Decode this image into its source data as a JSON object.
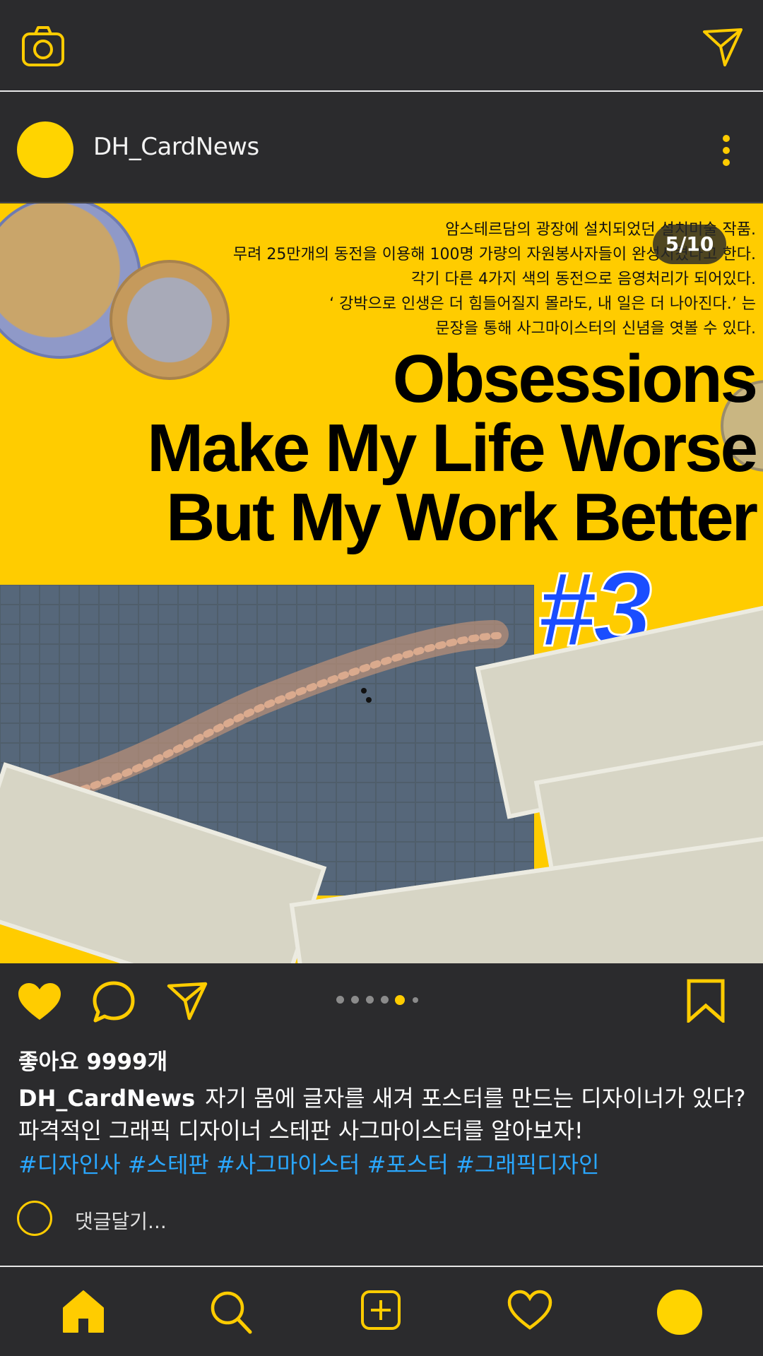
{
  "colors": {
    "accent": "#ffcc00",
    "background": "#2b2b2d",
    "hashtag": "#2aa7ff",
    "badge_blue": "#1a4dff"
  },
  "topbar": {
    "left_icon": "camera-icon",
    "right_icon": "send-icon"
  },
  "post": {
    "username": "DH_CardNews",
    "more_icon": "more-vertical-icon",
    "carousel": {
      "page_label": "5/10",
      "current": 5,
      "total": 10,
      "dots": 6,
      "active_dot": 5
    },
    "card": {
      "ko_lines": [
        "암스테르담의 광장에 설치되었던 설치미술 작품.",
        "무려 25만개의 동전을 이용해 100명 가량의 자원봉사자들이 완성시켰다고 한다.",
        "각기 다른 4가지 색의 동전으로 음영처리가 되어있다.",
        "‘ 강박으로 인생은 더 힘들어질지 몰라도, 내 일은 더 나아진다.’ 는",
        "문장을 통해 사그마이스터의 신념을 엿볼 수 있다."
      ],
      "headline_lines": [
        "Obsessions",
        "Make My Life Worse",
        "But My Work Better"
      ],
      "number_badge": "#3"
    },
    "likes": "좋아요 9999개",
    "caption_user": "DH_CardNews",
    "caption_text": "자기 몸에 글자를 새겨 포스터를 만드는 디자이너가 있다? 파격적인 그래픽 디자이너 스테판 사그마이스터를 알아보자!",
    "hashtags": "#디자인사 #스테판 #사그마이스터 #포스터 #그래픽디자인",
    "comment_placeholder": "댓글달기..."
  },
  "actions": {
    "like_icon": "heart-filled-icon",
    "comment_icon": "comment-icon",
    "share_icon": "send-icon",
    "save_icon": "bookmark-icon"
  },
  "bottom_nav": [
    "home-icon",
    "search-icon",
    "add-post-icon",
    "activity-heart-icon",
    "profile-avatar"
  ]
}
